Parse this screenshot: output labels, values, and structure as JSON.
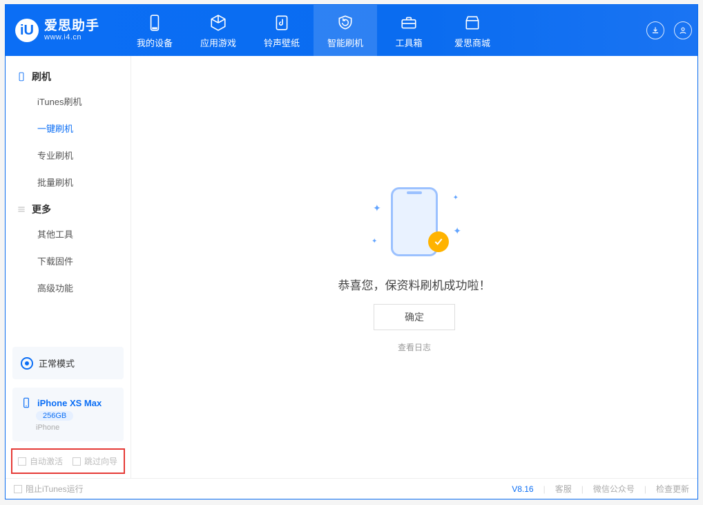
{
  "brand": {
    "title": "爱思助手",
    "subtitle": "www.i4.cn",
    "logo_letter": "iU"
  },
  "nav": {
    "items": [
      {
        "label": "我的设备"
      },
      {
        "label": "应用游戏"
      },
      {
        "label": "铃声壁纸"
      },
      {
        "label": "智能刷机"
      },
      {
        "label": "工具箱"
      },
      {
        "label": "爱思商城"
      }
    ]
  },
  "sidebar": {
    "section_flash": "刷机",
    "section_more": "更多",
    "items_flash": [
      {
        "label": "iTunes刷机"
      },
      {
        "label": "一键刷机"
      },
      {
        "label": "专业刷机"
      },
      {
        "label": "批量刷机"
      }
    ],
    "items_more": [
      {
        "label": "其他工具"
      },
      {
        "label": "下载固件"
      },
      {
        "label": "高级功能"
      }
    ],
    "mode_label": "正常模式",
    "device": {
      "name": "iPhone XS Max",
      "storage": "256GB",
      "type": "iPhone"
    },
    "check_auto_activate": "自动激活",
    "check_skip_guide": "跳过向导"
  },
  "main": {
    "success_msg": "恭喜您，保资料刷机成功啦！",
    "ok_label": "确定",
    "log_link": "查看日志"
  },
  "footer": {
    "block_itunes": "阻止iTunes运行",
    "version": "V8.16",
    "service": "客服",
    "wechat": "微信公众号",
    "update": "检查更新"
  },
  "colors": {
    "primary": "#0b6ef5",
    "accent_yellow": "#ffb300",
    "highlight_red": "#e53935"
  }
}
